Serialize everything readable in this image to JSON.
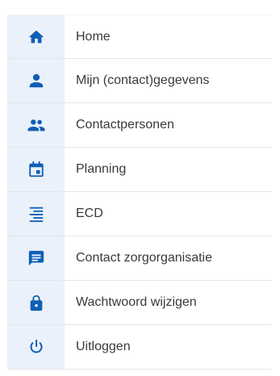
{
  "accent": "#0f5fb5",
  "menu": {
    "items": [
      {
        "label": "Home",
        "icon": "home-icon"
      },
      {
        "label": "Mijn (contact)gegevens",
        "icon": "person-icon"
      },
      {
        "label": "Contactpersonen",
        "icon": "people-icon"
      },
      {
        "label": "Planning",
        "icon": "calendar-icon"
      },
      {
        "label": "ECD",
        "icon": "list-icon"
      },
      {
        "label": "Contact zorgorganisatie",
        "icon": "message-icon"
      },
      {
        "label": "Wachtwoord wijzigen",
        "icon": "lock-icon"
      },
      {
        "label": "Uitloggen",
        "icon": "power-icon"
      }
    ]
  }
}
